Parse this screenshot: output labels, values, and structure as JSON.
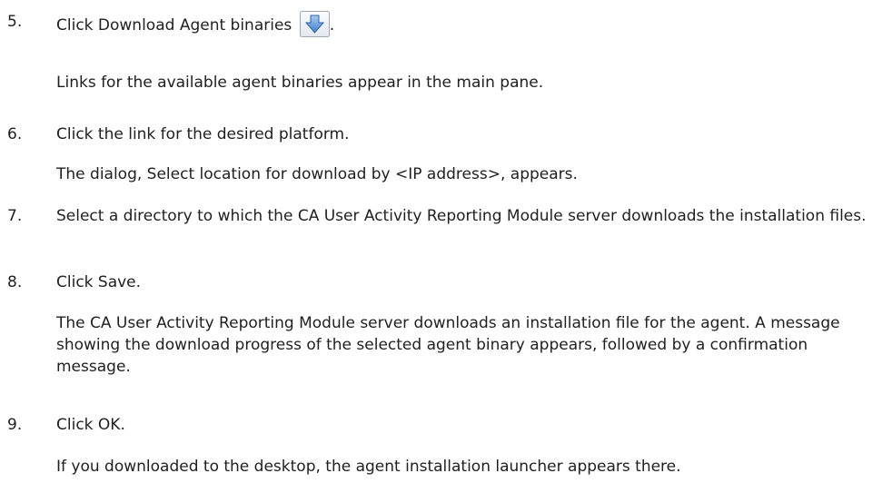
{
  "steps": [
    {
      "number": "5.",
      "instruction": "Click Download Agent binaries",
      "icon": "download-arrow-icon",
      "instruction_suffix": ".",
      "result": "Links for the available agent binaries appear in the main pane."
    },
    {
      "number": "6.",
      "instruction": "Click the link for the desired platform.",
      "result": "The dialog, Select location for download by <IP address>, appears."
    },
    {
      "number": "7.",
      "instruction": "Select a directory to which the CA User Activity Reporting Module server downloads the installation files."
    },
    {
      "number": "8.",
      "instruction": "Click Save.",
      "result": "The CA User Activity Reporting Module server downloads an installation file for the agent. A message showing the download progress of the selected agent binary appears, followed by a confirmation message."
    },
    {
      "number": "9.",
      "instruction": "Click OK.",
      "result": "If you downloaded to the desktop, the agent installation launcher appears there."
    }
  ],
  "colors": {
    "text": "#1f1f1f",
    "icon_arrow": "#5a8fd0",
    "icon_frame": "#9ea7b3"
  }
}
